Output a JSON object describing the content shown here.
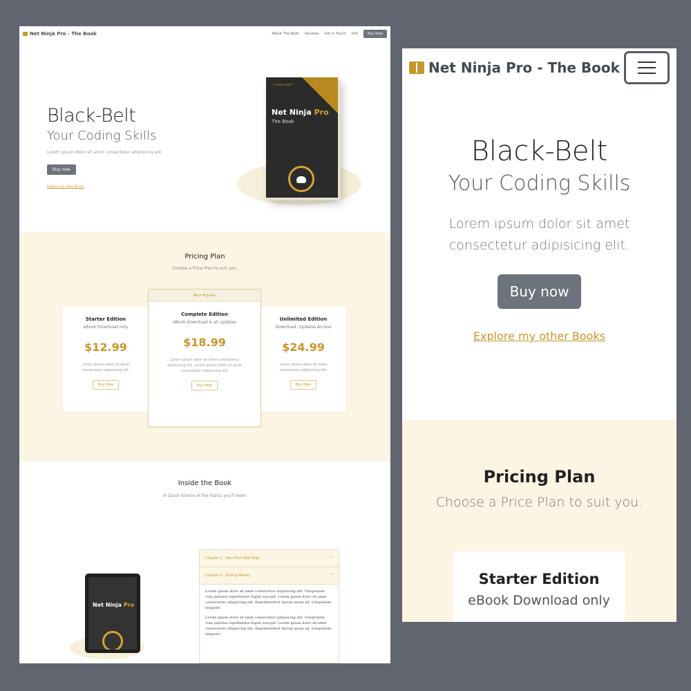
{
  "desktop": {
    "nav": {
      "brand": "Net Ninja Pro - The Book",
      "links": [
        "About The Book",
        "Reviews",
        "Get in Touch",
        "Info"
      ],
      "cta": "Buy Now"
    },
    "hero": {
      "title": "Black-Belt",
      "subtitle": "Your Coding Skills",
      "lead": "Lorem ipsum dolor sit amet consectetur adipisicing elit.",
      "buy": "Buy now",
      "explore": "Explore my other Books"
    },
    "book": {
      "quote": "\"a must read\"",
      "title_main": "Net Ninja ",
      "title_accent": "Pro",
      "subtitle": "The Book"
    },
    "pricing": {
      "title": "Pricing Plan",
      "subtitle": "Choose a Price Plan to suit you.",
      "ribbon": "Most Popular",
      "plans": [
        {
          "title": "Starter Edition",
          "sub": "eBook Download only",
          "price": "$12.99",
          "desc": "Lorem ipsum dolor sit amet consectetur adipisicing elit.",
          "btn": "Buy Now"
        },
        {
          "title": "Complete Edition",
          "sub": "eBook Download & all updates",
          "price": "$18.99",
          "desc": "Lorem ipsum dolor sit amet consectetur adipisicing elit. Lorem ipsum dolor sit amet consectetur adipisicing elit.",
          "btn": "Buy Now"
        },
        {
          "title": "Unlimited Edition",
          "sub": "Download, Updates Access",
          "price": "$24.99",
          "desc": "Lorem ipsum dolor sit amet consectetur adipisicing elit.",
          "btn": "Buy Now"
        }
      ]
    },
    "inside": {
      "title": "Inside the Book",
      "subtitle": "A Quick Glance at the topics you'll learn",
      "tablet_title_main": "Net Ninja ",
      "tablet_title_accent": "Pro",
      "chapters": [
        "Chapter 1 - Your First Web Page",
        "Chapter 2 - Styling Money"
      ],
      "body": [
        "Lorem ipsum dolor sit amet consectetur adipisicing elit. Voluptatem cum pariatur repellendus fugiat suscipit. Lorem ipsum dolor sit amet consectetur adipisicing elit. Reprehenderit harum quam ad, voluptatem tempore.",
        "Lorem ipsum dolor sit amet consectetur adipisicing elit. Voluptatem cum pariatur repellendus fugiat suscipit. Lorem ipsum dolor sit amet consectetur adipisicing elit. Reprehenderit harum quam ad, voluptatem tempore."
      ]
    }
  },
  "mobile": {
    "brand": "Net Ninja Pro - The Book",
    "hero": {
      "title": "Black-Belt",
      "subtitle": "Your Coding Skills",
      "lead": "Lorem ipsum dolor sit amet consectetur adipisicing elit.",
      "buy": "Buy now",
      "explore": "Explore my other Books"
    },
    "pricing": {
      "title": "Pricing Plan",
      "subtitle": "Choose a Price Plan to suit you.",
      "card_title": "Starter Edition",
      "card_sub": "eBook Download only"
    }
  },
  "colors": {
    "accent": "#c8962a",
    "pricing_bg": "#fcf5e3",
    "button": "#6c737c",
    "frame_bg": "#606570"
  },
  "icons": [
    "book-icon",
    "hamburger-menu-icon",
    "chevron-up-icon"
  ]
}
